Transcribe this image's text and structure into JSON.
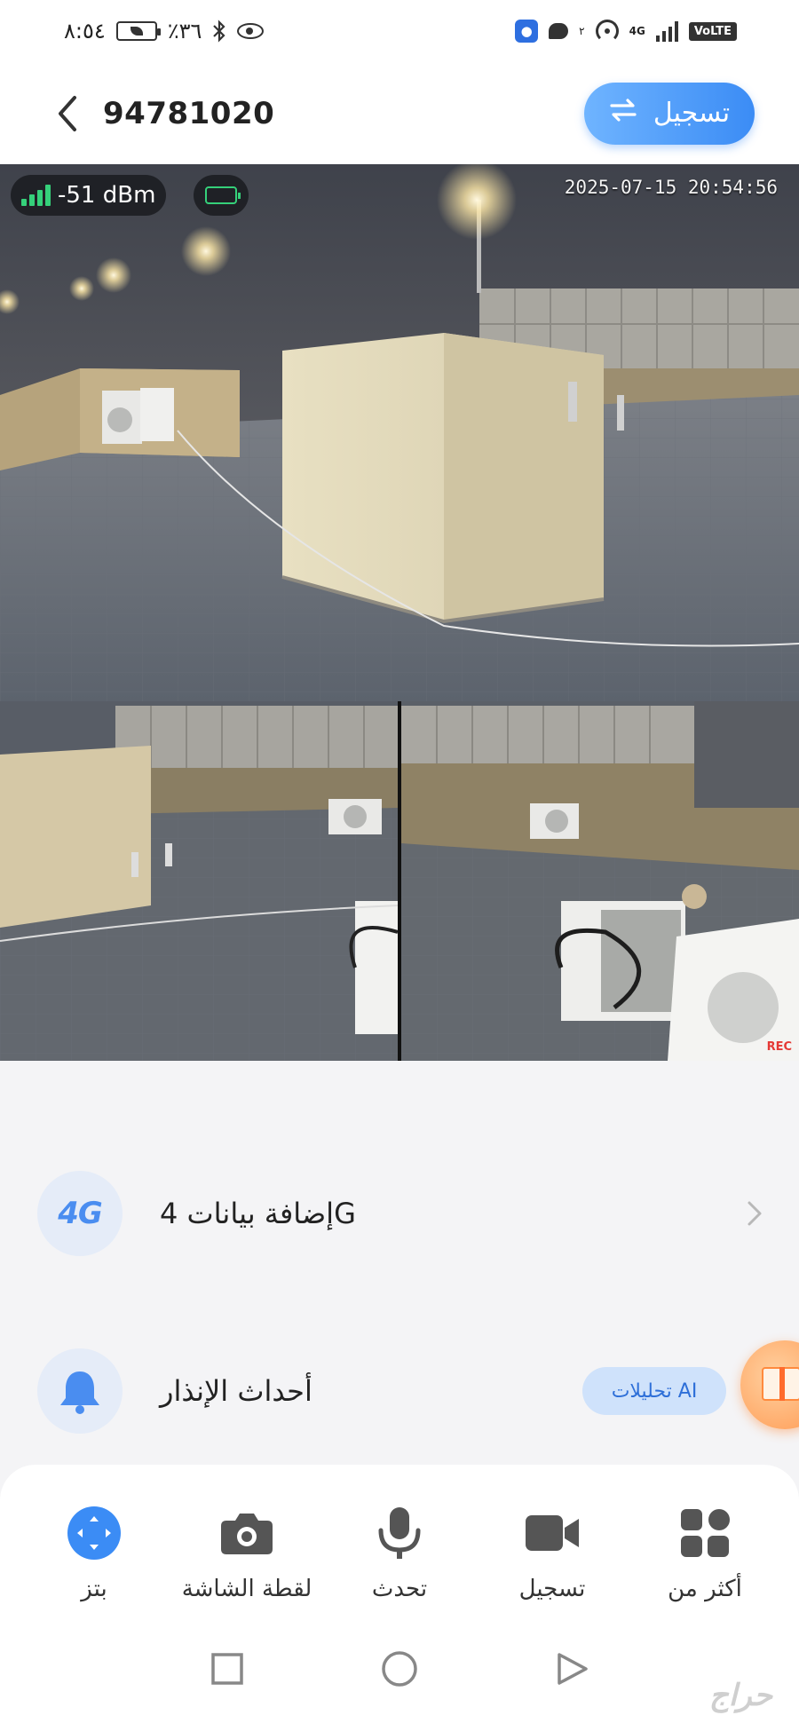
{
  "status_bar": {
    "time": "٨:٥٤",
    "battery_percent": "٪٣٦",
    "network": "4G",
    "volte": "VoLTE",
    "chat_badge": "٢"
  },
  "header": {
    "device_name": "94781020",
    "record_button_label": "تسجيل"
  },
  "camera": {
    "signal_text": "-51 dBm",
    "signal_level": 4,
    "battery_level": 1.0,
    "timestamp": "2025-07-15 20:54:56",
    "rec_tag": "REC"
  },
  "rows": {
    "data": {
      "icon_text": "4G",
      "label": "إضافة بيانات 4G"
    },
    "alarm": {
      "label": "أحداث الإنذار",
      "ai_label": "تحليلات AI"
    }
  },
  "toolbar": {
    "ptz": "بتز",
    "screenshot": "لقطة الشاشة",
    "talk": "تحدث",
    "record": "تسجيل",
    "more": "أكثر من"
  },
  "watermark": "حراج",
  "colors": {
    "accent": "#3b8cf5",
    "signal_green": "#35d07a"
  }
}
